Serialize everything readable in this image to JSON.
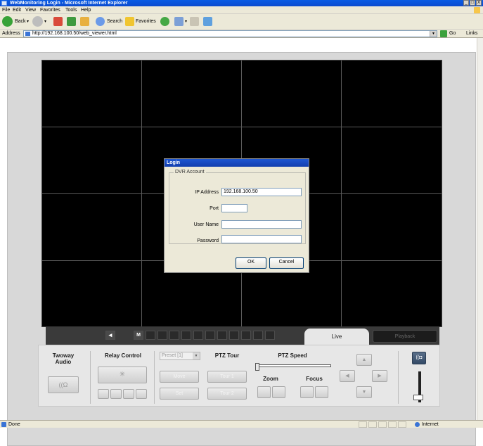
{
  "window": {
    "title": "WebMonitoring Login - Microsoft Internet Explorer",
    "controls": [
      "_",
      "□",
      "X"
    ]
  },
  "menubar": {
    "items": [
      "File",
      "Edit",
      "View",
      "Favorites",
      "Tools",
      "Help"
    ]
  },
  "toolbar": {
    "back_label": "Back",
    "search_label": "Search",
    "favorites_label": "Favorites"
  },
  "address": {
    "label": "Address",
    "url": "http://192.168.100.50/web_viewer.html",
    "go_label": "Go",
    "links_label": "Links"
  },
  "login": {
    "title": "Login",
    "group_label": "DVR Account",
    "fields": [
      {
        "label": "IP Address",
        "value": "192.168.100.50"
      },
      {
        "label": "Port",
        "value": ""
      },
      {
        "label": "User Name",
        "value": ""
      },
      {
        "label": "Password",
        "value": ""
      }
    ],
    "ok_label": "OK",
    "cancel_label": "Cancel"
  },
  "tabs": {
    "live_label": "Live",
    "playback_label": "Playback",
    "multi_label": "M"
  },
  "controls": {
    "twoway_label": "Twoway\nAudio",
    "relay_label": "Relay Control",
    "preset_value": "Preset [1]",
    "ptz_tour_label": "PTZ Tour",
    "ptz_speed_label": "PTZ Speed",
    "move_label": "Move",
    "set_label": "Set",
    "tour1_label": "Tour 1",
    "tour2_label": "Tour 2",
    "zoom_label": "Zoom",
    "focus_label": "Focus",
    "speed_level": 0
  },
  "statusbar": {
    "status_text": "Done",
    "zone_text": "Internet"
  }
}
